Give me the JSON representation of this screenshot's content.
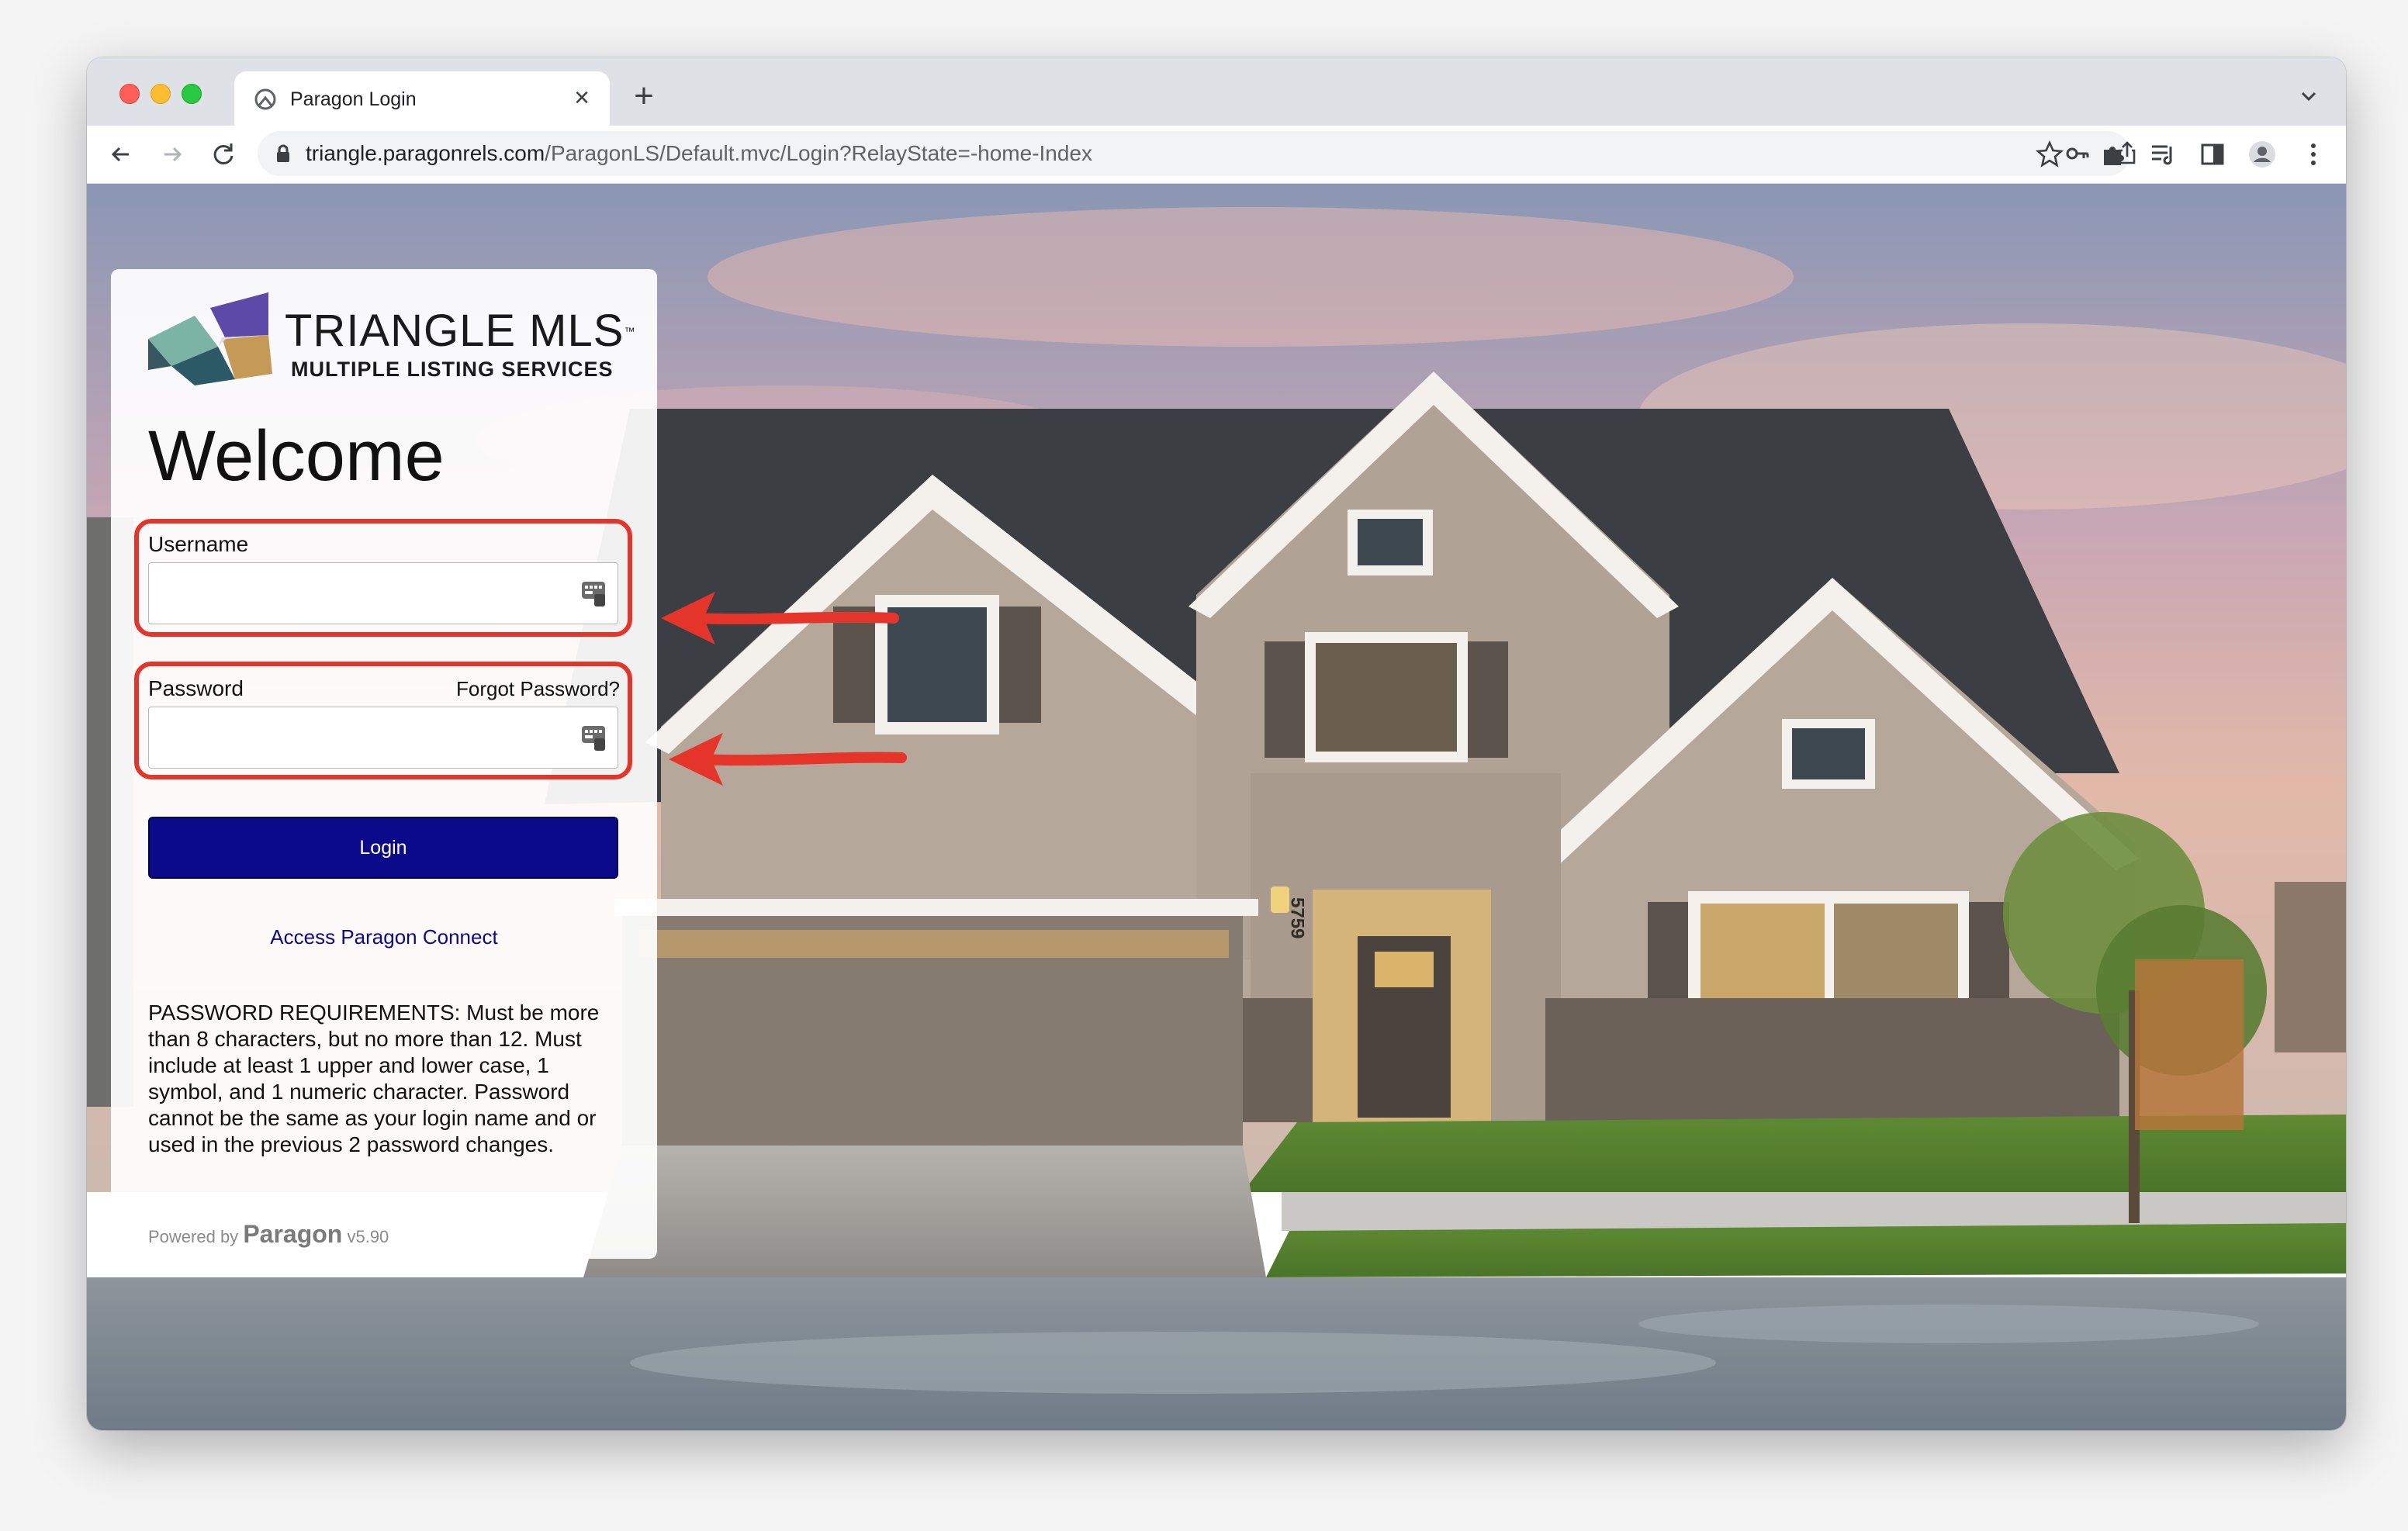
{
  "browser": {
    "tab_title": "Paragon Login",
    "new_tab_label": "+",
    "close_label": "×",
    "url_host": "triangle.paragonrels.com",
    "url_path": "/ParagonLS/Default.mvc/Login?RelayState=-home-Index"
  },
  "login": {
    "logo_title": "TRIANGLE MLS",
    "logo_tm": "™",
    "logo_subtitle": "MULTIPLE LISTING SERVICES",
    "welcome": "Welcome",
    "username_label": "Username",
    "username_value": "",
    "password_label": "Password",
    "password_value": "",
    "forgot_password": "Forgot Password?",
    "login_button": "Login",
    "connect_link": "Access Paragon Connect",
    "requirements": "PASSWORD REQUIREMENTS: Must be more than 8 characters, but no more than 12. Must include at least 1 upper and lower case, 1 symbol, and 1 numeric character. Password cannot be the same as your login name and or used in the previous 2 password changes.",
    "powered_by": "Powered by",
    "powered_brand": "Paragon",
    "version": "v5.90"
  },
  "scene": {
    "house_number": "5759"
  },
  "colors": {
    "highlight": "#e5352b",
    "login_button": "#0a0a8a",
    "link": "#0a0a8a"
  }
}
